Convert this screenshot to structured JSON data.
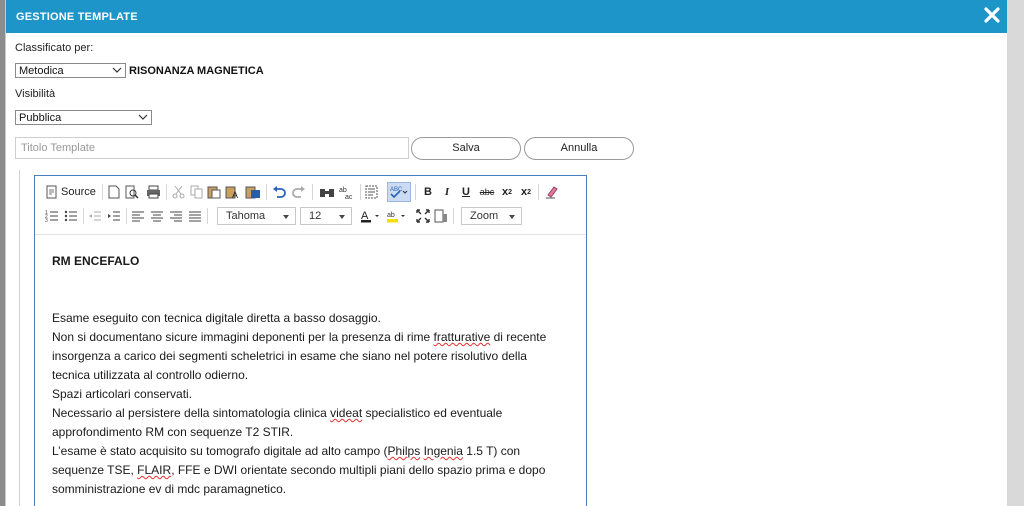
{
  "modal": {
    "title": "GESTIONE TEMPLATE",
    "close_glyph": "✕"
  },
  "form": {
    "classified_label": "Classificato per:",
    "classified_value": "Metodica",
    "modality": "RISONANZA MAGNETICA",
    "visibility_label": "Visibilità",
    "visibility_value": "Pubblica",
    "template_title_placeholder": "Titolo Template",
    "save_label": "Salva",
    "cancel_label": "Annulla"
  },
  "toolbar": {
    "source_label": "Source",
    "font_name": "Tahoma",
    "font_size": "12",
    "zoom_label": "Zoom",
    "bold_glyph": "B",
    "italic_glyph": "I",
    "underline_glyph": "U",
    "strike_glyph": "abc",
    "subscript_glyph": "x",
    "subscript_mark": "2",
    "superscript_glyph": "x",
    "superscript_mark": "2",
    "icons": [
      "source-icon",
      "new-page-icon",
      "preview-icon",
      "print-icon",
      "cut-icon",
      "copy-icon",
      "paste-icon",
      "paste-text-icon",
      "paste-word-icon",
      "undo-icon",
      "redo-icon",
      "find-icon",
      "replace-icon",
      "select-all-icon",
      "spellcheck-icon",
      "bold-icon",
      "italic-icon",
      "underline-icon",
      "strike-icon",
      "subscript-icon",
      "superscript-icon",
      "remove-format-icon",
      "numbered-list-icon",
      "bulleted-list-icon",
      "outdent-icon",
      "indent-icon",
      "align-left-icon",
      "align-center-icon",
      "align-right-icon",
      "justify-icon",
      "text-color-icon",
      "bg-color-icon",
      "maximize-icon",
      "show-blocks-icon"
    ]
  },
  "document": {
    "heading": "RM ENCEFALO",
    "p1": "Esame eseguito con tecnica digitale diretta a basso dosaggio.",
    "p2a": "Non si documentano sicure immagini deponenti per la presenza di rime ",
    "p2b": "fratturative",
    "p2c": " di recente insorgenza a carico dei segmenti scheletrici in esame che siano nel potere risolutivo della tecnica utilizzata al controllo odierno.",
    "p3": "Spazi articolari conservati.",
    "p4a": "Necessario al persistere della sintomatologia clinica ",
    "p4b": "videat",
    "p4c": " specialistico ed eventuale approfondimento RM con sequenze T2 STIR.",
    "p5a": "L’esame è stato acquisito su tomografo digitale ad alto campo (",
    "p5b": "Philps",
    "p5c": " ",
    "p5d": "Ingenia",
    "p5e": " 1.5 T) con sequenze TSE, ",
    "p5f": "FLAIR",
    "p5g": ", FFE e DWI orientate secondo multipli piani dello spazio prima e dopo somministrazione ev di mdc paramagnetico."
  },
  "colors": {
    "titlebar": "#1e95c9",
    "editor_border": "#4a7fc0",
    "spell_underline": "#e03030"
  }
}
